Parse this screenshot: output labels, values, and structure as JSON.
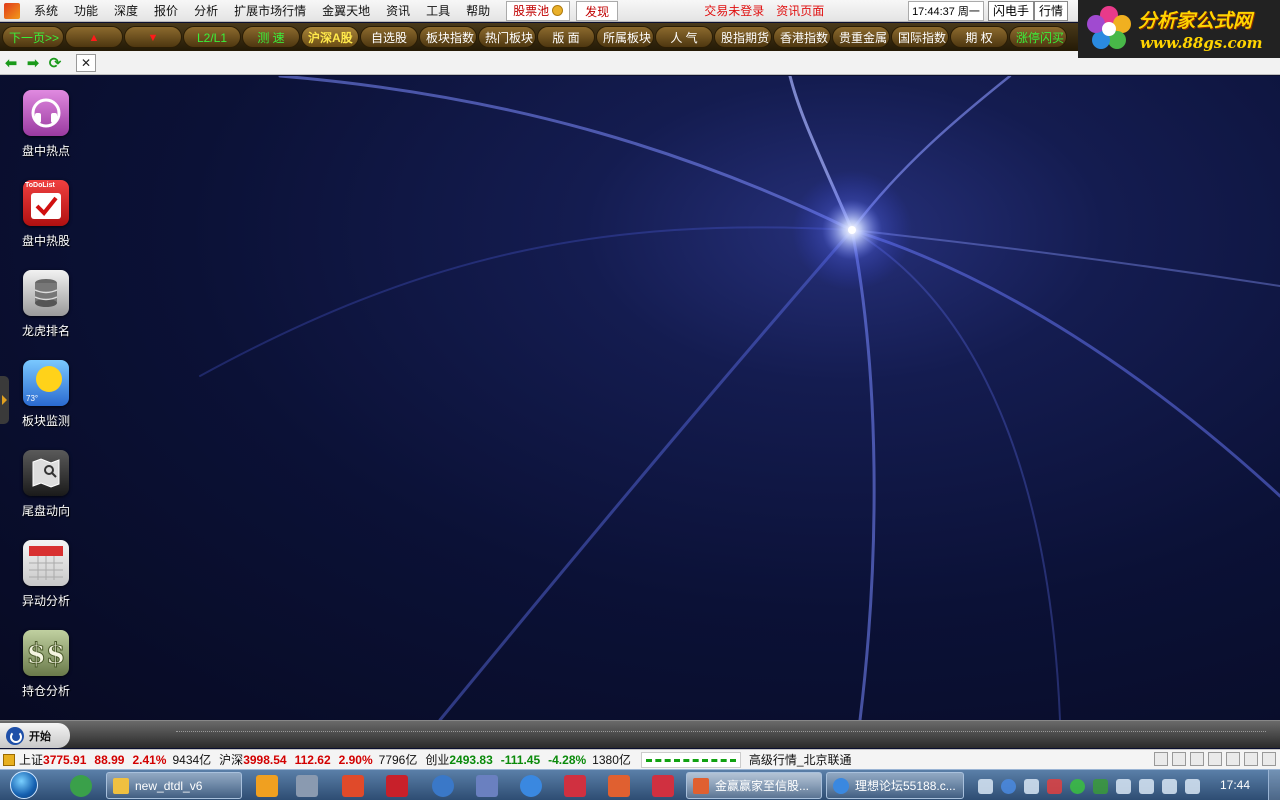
{
  "menu": {
    "items": [
      "系统",
      "功能",
      "深度",
      "报价",
      "分析",
      "扩展市场行情",
      "金翼天地",
      "资讯",
      "工具",
      "帮助"
    ],
    "stock_pool": "股票池",
    "discover": "发现",
    "trade_status": "交易未登录",
    "news_page": "资讯页面",
    "clock": "17:44:37 周一",
    "flash_trade": "闪电手",
    "quotes": "行情"
  },
  "logo": {
    "title": "分析家公式网",
    "url": "www.88gs.com"
  },
  "tabs": [
    {
      "label": "下一页>>",
      "style": "green"
    },
    {
      "label": "▲",
      "style": "arrow"
    },
    {
      "label": "▼",
      "style": "arrow"
    },
    {
      "label": "L2/L1",
      "style": "green"
    },
    {
      "label": "测 速",
      "style": "green"
    },
    {
      "label": "沪深A股",
      "style": "yellow"
    },
    {
      "label": "自选股",
      "style": "white"
    },
    {
      "label": "板块指数",
      "style": "white"
    },
    {
      "label": "热门板块",
      "style": "white"
    },
    {
      "label": "版 面",
      "style": "white"
    },
    {
      "label": "所属板块",
      "style": "white"
    },
    {
      "label": "人 气",
      "style": "white"
    },
    {
      "label": "股指期货",
      "style": "white"
    },
    {
      "label": "香港指数",
      "style": "white"
    },
    {
      "label": "贵重金属",
      "style": "white"
    },
    {
      "label": "国际指数",
      "style": "white"
    },
    {
      "label": "期 权",
      "style": "white"
    },
    {
      "label": "涨停闪买",
      "style": "green"
    }
  ],
  "desktop_icons": [
    {
      "label": "盘中热点",
      "icon": "headphones-icon"
    },
    {
      "label": "盘中热股",
      "icon": "todo-checklist-icon",
      "badge": "ToDoList"
    },
    {
      "label": "龙虎排名",
      "icon": "database-icon"
    },
    {
      "label": "板块监测",
      "icon": "weather-icon",
      "badge": "73°"
    },
    {
      "label": "尾盘动向",
      "icon": "map-icon"
    },
    {
      "label": "异动分析",
      "icon": "calendar-icon"
    },
    {
      "label": "持仓分析",
      "icon": "dollar-icon"
    }
  ],
  "startbar": {
    "start_label": "开始"
  },
  "ticker": {
    "sh_name": "上证",
    "sh_value": "3775.91",
    "sh_change": "88.99",
    "sh_pct": "2.41%",
    "sh_vol": "9434亿",
    "hs_name": "沪深",
    "hs_value": "3998.54",
    "hs_change": "112.62",
    "hs_pct": "2.90%",
    "hs_vol": "7796亿",
    "cy_name": "创业",
    "cy_value": "2493.83",
    "cy_change": "-111.45",
    "cy_pct": "-4.28%",
    "cy_vol": "1380亿",
    "feed": "高级行情_北京联通"
  },
  "taskbar": {
    "tasks": [
      "new_dtdl_v6",
      "金赢赢家至信股...",
      "理想论坛55188.c..."
    ],
    "clock": "17:44"
  },
  "colors": {
    "up": "#d20000",
    "down": "#0a8a0a",
    "logo_text": "#ffd400",
    "tab_bg": "#6a4c14"
  }
}
